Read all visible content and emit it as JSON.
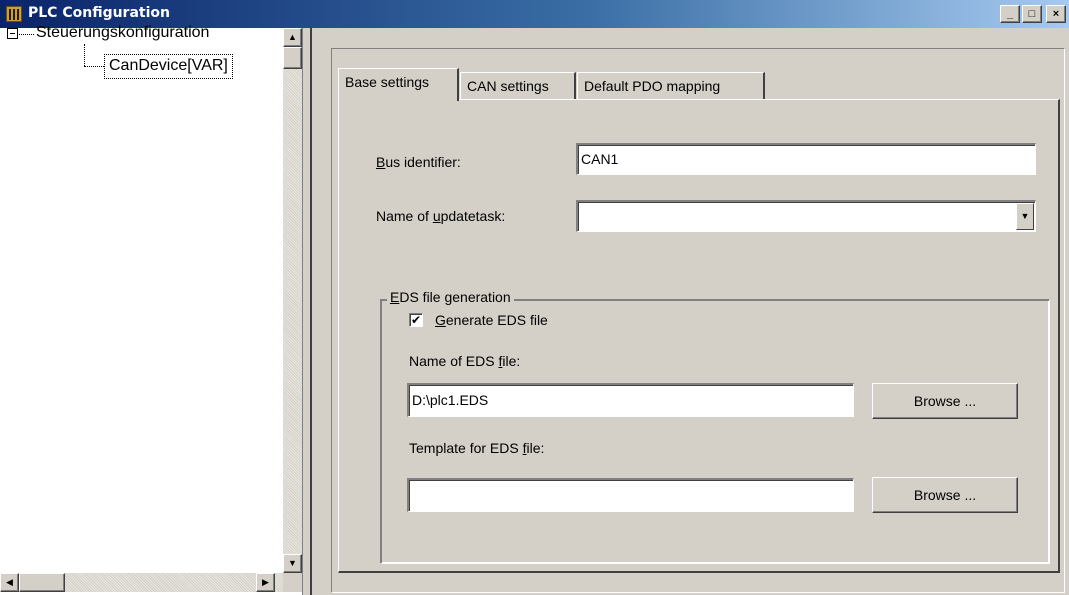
{
  "window": {
    "title": "PLC Configuration",
    "icon": "plc-config-icon",
    "controls": {
      "minimize": "_",
      "maximize": "□",
      "close": "×"
    }
  },
  "tree": {
    "root_label": "Steuerungskonfiguration",
    "child_label": "CanDevice[VAR]"
  },
  "tabs": [
    {
      "label": "Base settings",
      "active": true
    },
    {
      "label": "CAN settings",
      "active": false
    },
    {
      "label": "Default PDO mapping",
      "active": false
    }
  ],
  "form": {
    "bus_identifier_label_pre": "",
    "bus_identifier_label_key": "B",
    "bus_identifier_label_post": "us identifier:",
    "bus_identifier_value": "CAN1",
    "updatetask_label_pre": "Name of ",
    "updatetask_label_key": "u",
    "updatetask_label_post": "pdatetask:",
    "updatetask_value": "",
    "eds_group_key": "E",
    "eds_group_post": "DS file generation",
    "generate_eds_checked": true,
    "generate_eds_key": "G",
    "generate_eds_post": "enerate EDS file",
    "eds_file_label_pre": "Name of EDS ",
    "eds_file_label_key": "f",
    "eds_file_label_post": "ile:",
    "eds_file_value": "D:\\plc1.EDS",
    "template_label_pre": "Template for EDS ",
    "template_label_key": "f",
    "template_label_post": "ile:",
    "template_value": "",
    "browse_label": "Browse ..."
  }
}
